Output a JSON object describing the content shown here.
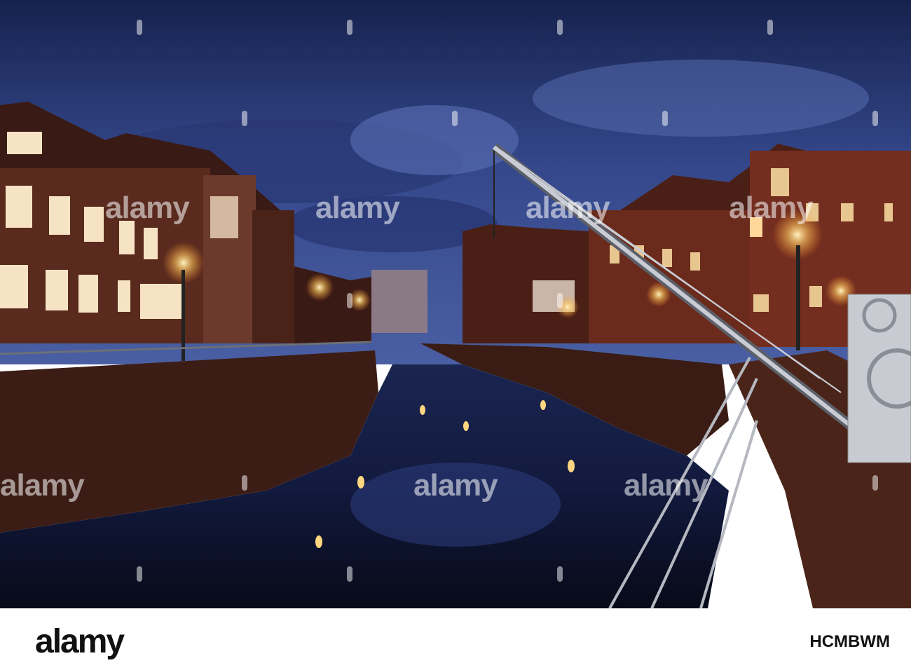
{
  "watermark": {
    "text": "alamy"
  },
  "footer": {
    "logo": "alamy",
    "image_id": "HCMBWM"
  },
  "colors": {
    "sky_top": "#1c2a5c",
    "sky_mid": "#3a4d90",
    "water": "#0e1430",
    "lamp": "#ffd680",
    "brick": "#6b2e20"
  }
}
